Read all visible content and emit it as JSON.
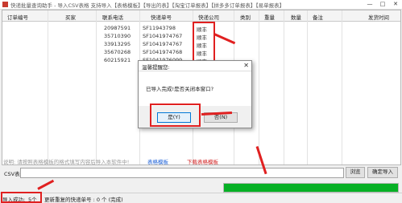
{
  "window": {
    "title": "快递批量查询助手 - 导入CSV表格  支持导入【表格模板】【导出的表】【淘宝订单报表】【拼多多订单报表】【易单报表】",
    "minimize": "—",
    "maximize": "□",
    "close": "✕"
  },
  "table": {
    "headers": [
      "订单编号",
      "买家",
      "联系电话",
      "快递单号",
      "快递公司",
      "类别",
      "重量",
      "数量",
      "备注",
      "发货时间"
    ],
    "rows": [
      {
        "phone": "20987591",
        "tracking": "SF11943798",
        "company": "顺丰"
      },
      {
        "phone": "35710390",
        "tracking": "SF1041974767",
        "company": "顺丰"
      },
      {
        "phone": "33913295",
        "tracking": "SF1041974767",
        "company": "顺丰"
      },
      {
        "phone": "35670268",
        "tracking": "SF1041974768",
        "company": "顺丰"
      },
      {
        "phone": "60215921",
        "tracking": "SF1041976099",
        "company": "顺丰"
      }
    ]
  },
  "dialog": {
    "title": "温馨提醒您:",
    "close": "✕",
    "message": "已导入完成!是否关闭本窗口?",
    "yes_label": "是(Y)",
    "no_label": "否(N)"
  },
  "info_bar": {
    "text": "说明: 请按照表格模板的格式填写内容后导入本软件中!",
    "template_link": "表格模板",
    "download_link": "下载表格模板"
  },
  "csv": {
    "label": "CSV表格:",
    "value": "",
    "browse_label": "浏览",
    "import_label": "确定导入"
  },
  "progress": {
    "value": 1.0,
    "color": "#06b025"
  },
  "status": {
    "success_label": "导入成功:",
    "success_count": "5个",
    "duplicate_text": "更新重复的快递单号 : 0 个 (完成)"
  }
}
